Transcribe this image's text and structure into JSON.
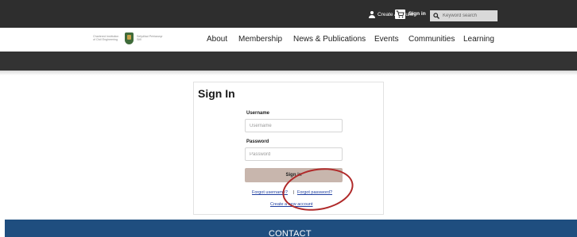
{
  "topbar": {
    "create_account": "Create Account",
    "sign_in": "Sign in",
    "search_placeholder": "Keyword search",
    "icons": [
      "user-icon",
      "cart-icon",
      "search-icon"
    ]
  },
  "logo": {
    "left_text": "Chartered Institution of Civil Engineering",
    "right_text": "Sefydliad Peirianwyr Sifil"
  },
  "nav": {
    "items": [
      "About",
      "Membership",
      "News & Publications",
      "Events",
      "Communities",
      "Learning"
    ]
  },
  "signin_form": {
    "title": "Sign In",
    "username_label": "Username",
    "username_placeholder": "Username",
    "password_label": "Password",
    "password_placeholder": "Password",
    "button_label": "Sign in",
    "forgot_username": "Forgot username?",
    "separator": "|",
    "forgot_password": "Forgot password?",
    "create_account": "Create a new account"
  },
  "annotation": {
    "color": "#b02a2a",
    "shape": "ellipse",
    "target": "Forgot password?"
  },
  "footer": {
    "contact_label": "CONTACT"
  },
  "colors": {
    "topbar": "#2e2e2e",
    "subbar": "#333333",
    "signin_button": "#c8b6ad",
    "footer": "#1f4e7f",
    "link": "#1f3fa0"
  }
}
